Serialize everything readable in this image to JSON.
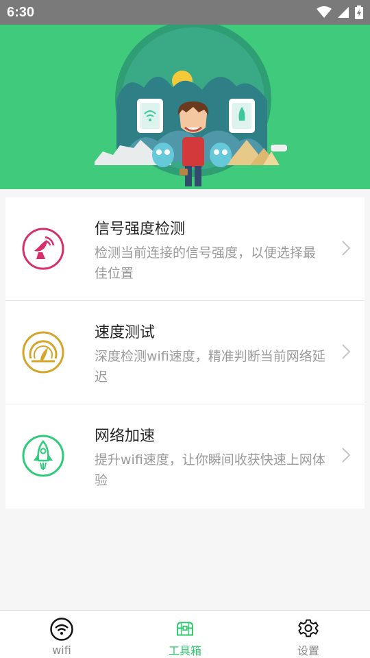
{
  "status_bar": {
    "time": "6:30"
  },
  "tools": [
    {
      "title": "信号强度检测",
      "desc": "检测当前连接的信号强度，以便选择最佳位置",
      "icon": "satellite-dish-icon",
      "color": "#d6306c"
    },
    {
      "title": "速度测试",
      "desc": "深度检测wifi速度，精准判断当前网络延迟",
      "icon": "speedometer-icon",
      "color": "#d4a52b"
    },
    {
      "title": "网络加速",
      "desc": "提升wifi速度，让你瞬间收获快速上网体验",
      "icon": "rocket-icon",
      "color": "#2ecb7a"
    }
  ],
  "tabs": [
    {
      "label": "wifi",
      "icon": "wifi-icon",
      "active": false
    },
    {
      "label": "工具箱",
      "icon": "toolbox-icon",
      "active": true
    },
    {
      "label": "设置",
      "icon": "gear-icon",
      "active": false
    }
  ],
  "colors": {
    "banner": "#3fca7c",
    "accent": "#2dc76d",
    "status_bar": "#7a7a7a"
  }
}
